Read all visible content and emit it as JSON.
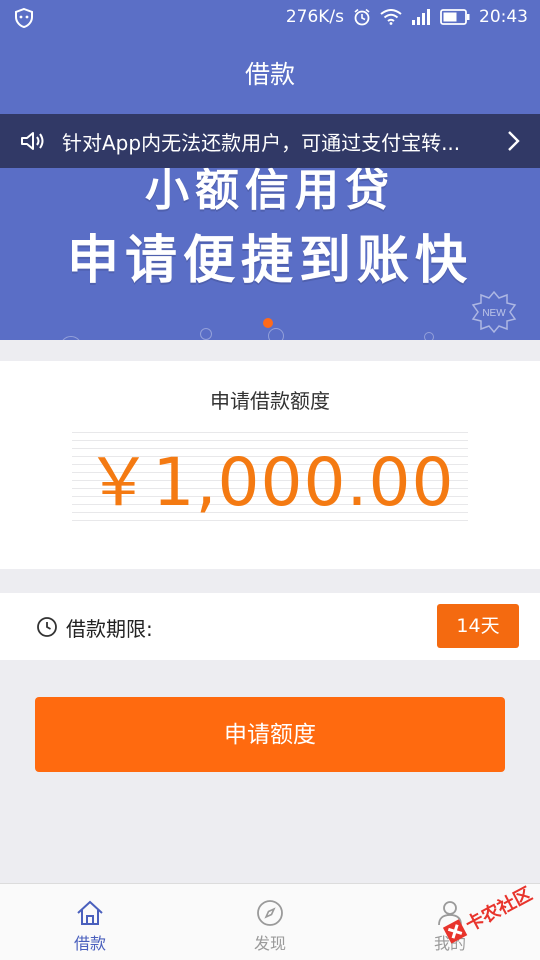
{
  "status_bar": {
    "speed": "276K/s",
    "time": "20:43"
  },
  "nav": {
    "title": "借款"
  },
  "banner": {
    "line1": "小额信用贷",
    "line2": "申请便捷到账快",
    "badge": "NEW"
  },
  "notice": {
    "text": "针对App内无法还款用户，可通过支付宝转..."
  },
  "amount": {
    "label": "申请借款额度",
    "value": "￥1,000.00"
  },
  "term": {
    "label": "借款期限:",
    "value": "14天"
  },
  "apply_button": {
    "label": "申请额度"
  },
  "tabs": [
    {
      "label": "借款",
      "icon": "home-icon"
    },
    {
      "label": "发现",
      "icon": "compass-icon"
    },
    {
      "label": "我的",
      "icon": "user-icon"
    }
  ],
  "watermark": {
    "text": "卡农社区"
  },
  "colors": {
    "primary": "#5b6fc6",
    "accent": "#ff6a0f",
    "amount_text": "#f47a12"
  }
}
